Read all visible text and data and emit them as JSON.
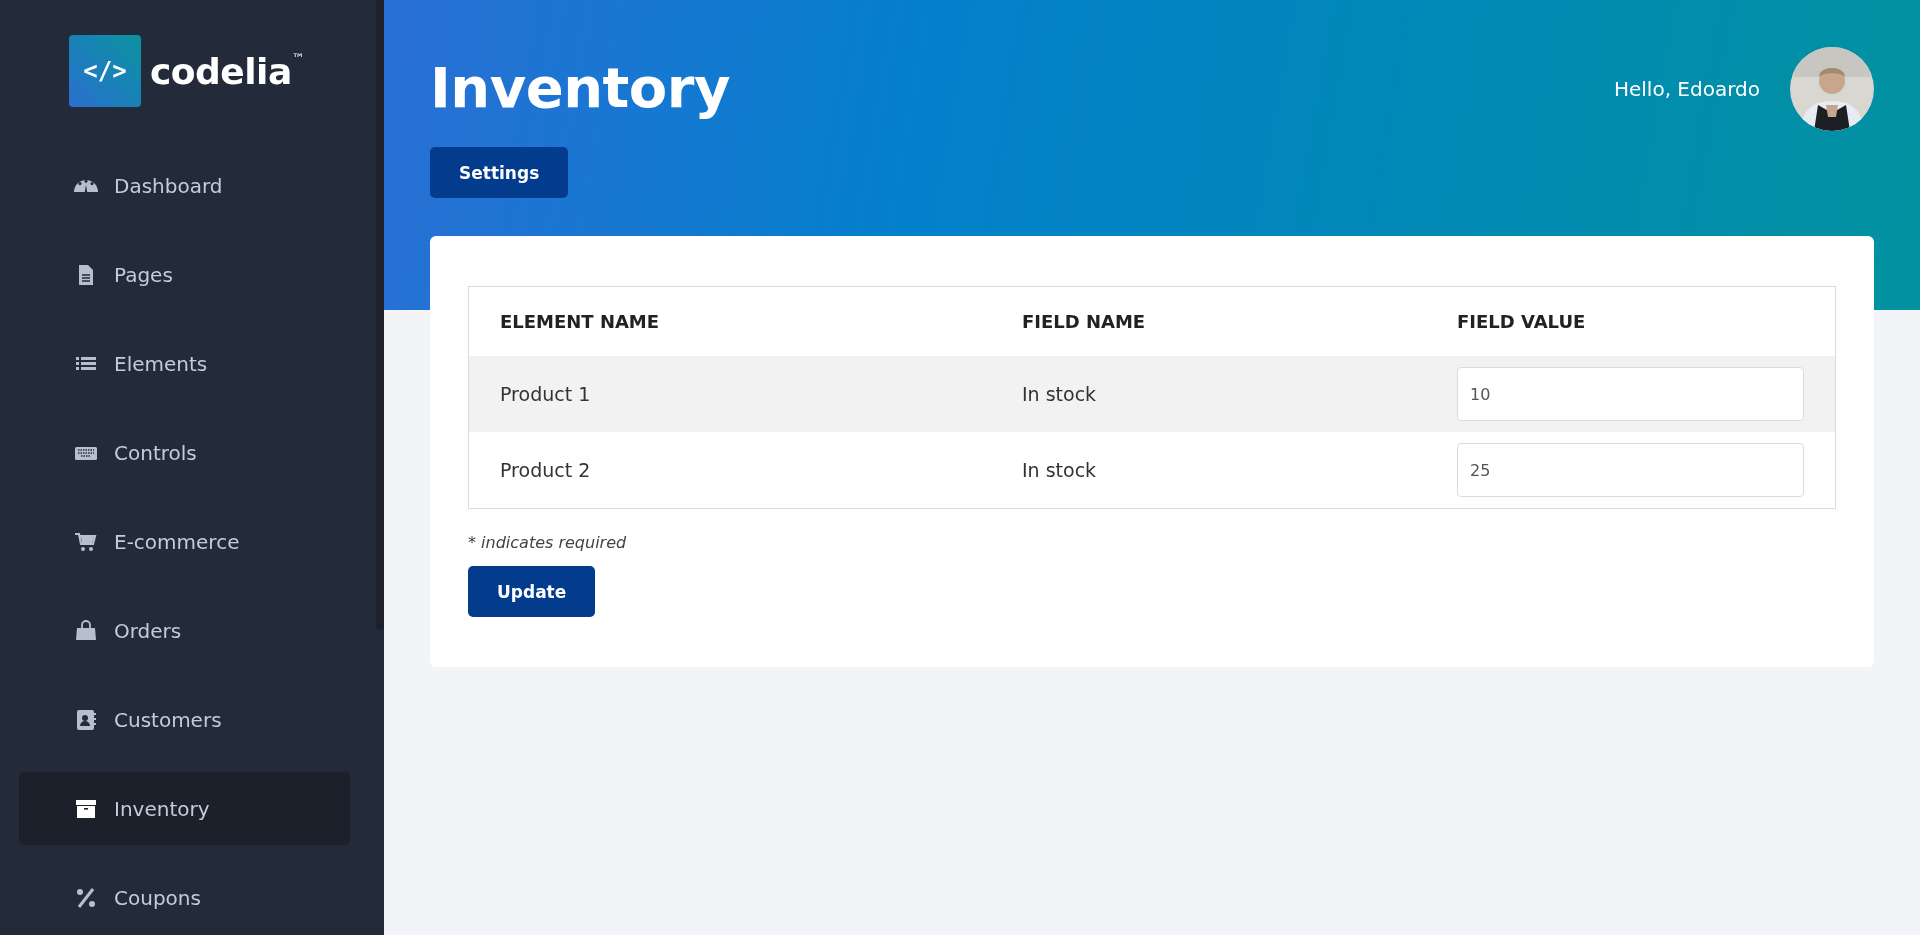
{
  "brand": {
    "name": "codelia",
    "mark": "™",
    "logo_text": "</>"
  },
  "sidebar": {
    "items": [
      {
        "label": "Dashboard",
        "kind": "gauge",
        "selected": false
      },
      {
        "label": "Pages",
        "kind": "file",
        "selected": false
      },
      {
        "label": "Elements",
        "kind": "list",
        "selected": false
      },
      {
        "label": "Controls",
        "kind": "keyboard",
        "selected": false
      },
      {
        "label": "E-commerce",
        "kind": "cart",
        "selected": false
      },
      {
        "label": "Orders",
        "kind": "bag",
        "selected": false
      },
      {
        "label": "Customers",
        "kind": "contact",
        "selected": false
      },
      {
        "label": "Inventory",
        "kind": "box",
        "selected": true
      },
      {
        "label": "Coupons",
        "kind": "percent",
        "selected": false
      }
    ]
  },
  "header": {
    "title": "Inventory",
    "settings_button": "Settings",
    "greeting": "Hello, Edoardo"
  },
  "table": {
    "columns": [
      "ELEMENT NAME",
      "FIELD NAME",
      "FIELD VALUE"
    ],
    "rows": [
      {
        "element_name": "Product 1",
        "field_name": "In stock",
        "field_value": "10"
      },
      {
        "element_name": "Product 2",
        "field_name": "In stock",
        "field_value": "25"
      }
    ]
  },
  "note": "* indicates required",
  "submit_button": "Update"
}
